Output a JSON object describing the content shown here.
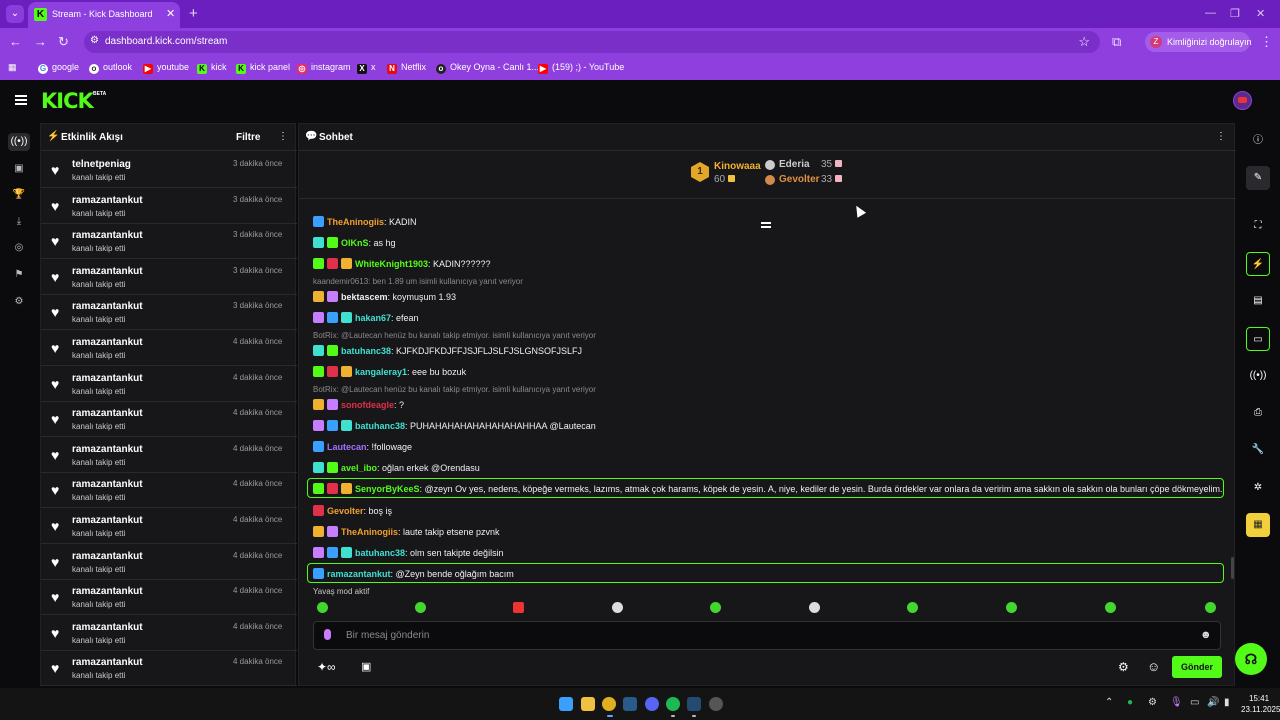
{
  "browser": {
    "tab_title": "Stream - Kick Dashboard",
    "tab_close": "✕",
    "tab_new": "+",
    "url": "dashboard.kick.com/stream",
    "profile_label": "Kimliğinizi doğrulayın",
    "profile_initial": "Z",
    "bookmarks": [
      "google",
      "outlook",
      "youtube",
      "kick",
      "kick panel",
      "instagram",
      "x",
      "Netflix",
      "Okey Oyna - Canlı 1...",
      "(159) ;) - YouTube"
    ]
  },
  "colors": {
    "accent": "#53fc18",
    "browser_purple": "#8f3fde",
    "panel_bg": "#17171a"
  },
  "kick": {
    "logo": "KICK",
    "beta": "BETA"
  },
  "activity": {
    "title": "Etkinlik Akışı",
    "filter": "Filtre",
    "items": [
      {
        "user": "telnetpeniag",
        "action": "kanalı takip etti",
        "time": "3 dakika önce"
      },
      {
        "user": "ramazantankut",
        "action": "kanalı takip etti",
        "time": "3 dakika önce"
      },
      {
        "user": "ramazantankut",
        "action": "kanalı takip etti",
        "time": "3 dakika önce"
      },
      {
        "user": "ramazantankut",
        "action": "kanalı takip etti",
        "time": "3 dakika önce"
      },
      {
        "user": "ramazantankut",
        "action": "kanalı takip etti",
        "time": "3 dakika önce"
      },
      {
        "user": "ramazantankut",
        "action": "kanalı takip etti",
        "time": "4 dakika önce"
      },
      {
        "user": "ramazantankut",
        "action": "kanalı takip etti",
        "time": "4 dakika önce"
      },
      {
        "user": "ramazantankut",
        "action": "kanalı takip etti",
        "time": "4 dakika önce"
      },
      {
        "user": "ramazantankut",
        "action": "kanalı takip etti",
        "time": "4 dakika önce"
      },
      {
        "user": "ramazantankut",
        "action": "kanalı takip etti",
        "time": "4 dakika önce"
      },
      {
        "user": "ramazantankut",
        "action": "kanalı takip etti",
        "time": "4 dakika önce"
      },
      {
        "user": "ramazantankut",
        "action": "kanalı takip etti",
        "time": "4 dakika önce"
      },
      {
        "user": "ramazantankut",
        "action": "kanalı takip etti",
        "time": "4 dakika önce"
      },
      {
        "user": "ramazantankut",
        "action": "kanalı takip etti",
        "time": "4 dakika önce"
      },
      {
        "user": "ramazantankut",
        "action": "kanalı takip etti",
        "time": "4 dakika önce"
      }
    ]
  },
  "chat": {
    "title": "Sohbet",
    "leaderboard": {
      "first": {
        "rank": "1",
        "name": "Kinowaaa",
        "value": "60"
      },
      "second": {
        "name": "Ederia",
        "value": "35"
      },
      "third": {
        "name": "Gevolter",
        "value": "33"
      }
    },
    "messages": [
      {
        "user": "TheAninogiis",
        "color": "#f0a030",
        "text": ": KADIN"
      },
      {
        "user": "OlKnS",
        "color": "#53fc18",
        "text": ": as hg"
      },
      {
        "user": "WhiteKnight1903",
        "color": "#53fc18",
        "text": ": KADIN??????"
      },
      {
        "reply": "kaandemir0613: ben 1.89 um isimli kullanıcıya yanıt veriyor"
      },
      {
        "user": "bektascem",
        "color": "#f0f0f0",
        "text": ": koymuşum 1.93"
      },
      {
        "user": "hakan67",
        "color": "#40e0d0",
        "text": ": efean"
      },
      {
        "reply": "BotRix: @Lautecan henüz bu kanalı takip etmiyor. isimli kullanıcıya yanıt veriyor"
      },
      {
        "user": "batuhanc38",
        "color": "#40e0d0",
        "text": ": KJFKDJFKDJFFJSJFLJSLFJSLGNSOFJSLFJ"
      },
      {
        "user": "kangaleray1",
        "color": "#40e0d0",
        "text": ": eee bu bozuk"
      },
      {
        "reply": "BotRix: @Lautecan henüz bu kanalı takip etmiyor. isimli kullanıcıya yanıt veriyor"
      },
      {
        "user": "sonofdeagle",
        "color": "#e0304a",
        "text": ": ?"
      },
      {
        "user": "batuhanc38",
        "color": "#40e0d0",
        "text": ": PUHAHAHAHAHAHAHAHAHHAA @Lautecan"
      },
      {
        "user": "Lautecan",
        "color": "#a070ff",
        "text": ": !followage"
      },
      {
        "user": "avel_ibo",
        "color": "#53fc18",
        "text": ": oğlan erkek @Orendasu"
      },
      {
        "user": "SenyorByKeeS",
        "color": "#53fc18",
        "text": ": @zeyn Ov yes, nedens, köpeğe vermeks, lazıms, atmak çok harams, köpek de yesin. A, niye, kediler de yesin. Burda ördekler var onlara da veririm ama sakkın ola sakkın ola bunları çöpe dökmeyelim.",
        "highlight": true
      },
      {
        "user": "Gevolter",
        "color": "#f0a030",
        "text": ": boş iş"
      },
      {
        "user": "TheAninogiis",
        "color": "#f0a030",
        "text": ": laute takip etsene pzvnk"
      },
      {
        "user": "batuhanc38",
        "color": "#40e0d0",
        "text": ": olm sen takipte değilsin"
      },
      {
        "user": "ramazantankut",
        "color": "#40e0d0",
        "text": ": @Zeyn bende oğlağım bacım",
        "highlight": true
      }
    ],
    "slow_mode": "Yavaş mod aktif",
    "input_placeholder": "Bir mesaj gönderin",
    "send_label": "Gönder"
  },
  "taskbar": {
    "time": "15:41",
    "date": "23.11.2025"
  }
}
